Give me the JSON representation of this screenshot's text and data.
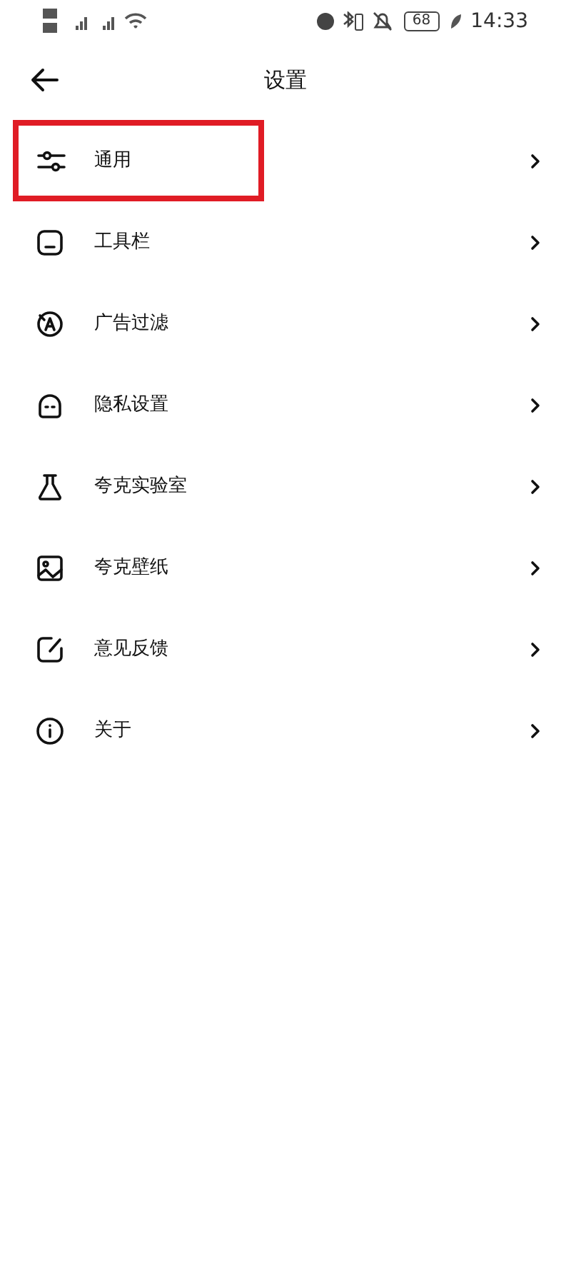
{
  "status_bar": {
    "battery": "68",
    "time": "14:33"
  },
  "header": {
    "title": "设置"
  },
  "items": [
    {
      "kind": "sliders",
      "label": "通用",
      "highlighted": true
    },
    {
      "kind": "toolbar",
      "label": "工具栏",
      "highlighted": false
    },
    {
      "kind": "adfilter",
      "label": "广告过滤",
      "highlighted": false
    },
    {
      "kind": "privacy",
      "label": "隐私设置",
      "highlighted": false
    },
    {
      "kind": "lab",
      "label": "夸克实验室",
      "highlighted": false
    },
    {
      "kind": "wallpaper",
      "label": "夸克壁纸",
      "highlighted": false
    },
    {
      "kind": "feedback",
      "label": "意见反馈",
      "highlighted": false
    },
    {
      "kind": "info",
      "label": "关于",
      "highlighted": false
    }
  ]
}
